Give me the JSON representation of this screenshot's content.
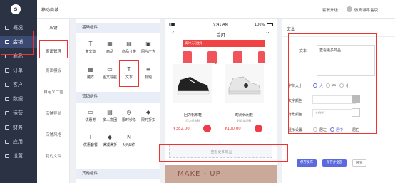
{
  "side": {
    "items": [
      {
        "label": "概况",
        "icon": "dashboard-icon"
      },
      {
        "label": "店铺",
        "icon": "store-icon"
      },
      {
        "label": "商品",
        "icon": "goods-icon"
      },
      {
        "label": "订单",
        "icon": "order-icon"
      },
      {
        "label": "客户",
        "icon": "customer-icon"
      },
      {
        "label": "数据",
        "icon": "data-icon"
      },
      {
        "label": "运营",
        "icon": "operations-icon"
      },
      {
        "label": "财务",
        "icon": "finance-icon"
      },
      {
        "label": "应用",
        "icon": "apps-icon"
      },
      {
        "label": "设置",
        "icon": "settings-icon"
      }
    ]
  },
  "topbar": {
    "breadcrumb": "移动商城",
    "upgrade": "套餐升级",
    "user": "微商城零售版"
  },
  "sub": {
    "items": [
      "店铺",
      "页面管理",
      "页面模板",
      "自定义广告",
      "店铺导航",
      "店铺风格",
      "我的文件"
    ]
  },
  "comp": {
    "basic_header": "基础组件",
    "basic": [
      "富文本",
      "商品",
      "商品分类",
      "图片广告",
      "魔方",
      "图文导航",
      "文本",
      "标题"
    ],
    "marketing_header": "营销组件",
    "marketing": [
      "优惠券",
      "多人拼团",
      "限时秒杀",
      "限时折扣",
      "优惠套餐",
      "满减满折",
      "N元N件"
    ],
    "other_header": "其他组件"
  },
  "phone": {
    "time": "9:41 AM",
    "battery": "100%",
    "title": "首页",
    "banner": "满99元可使用",
    "products": [
      {
        "name": "回力帆布鞋",
        "desc": "回力帆布鞋",
        "price": "¥382.00"
      },
      {
        "name": "时尚休闲鞋",
        "desc": "时尚休闲鞋",
        "price": "¥100.00"
      }
    ],
    "more_text": "查看更多商品",
    "model_text": "MAKE - UP"
  },
  "props": {
    "title": "文本",
    "text_label": "文本",
    "text_value": "查看更多商品...",
    "size_label": "字体大小",
    "sizes": [
      "大",
      "中",
      "小"
    ],
    "color_label": "文字颜色",
    "bg_label": "背景颜色",
    "bg_value": "#ffffff",
    "display_label": "显示设置",
    "align": [
      "居左",
      "居中",
      "居右"
    ],
    "btn_save_publish": "保存发布",
    "btn_save_draft": "保存并全部",
    "btn_preview": "预览"
  },
  "colors": {
    "sidebar": "#2b3244",
    "accent": "#5b6bdf",
    "highlight": "#e33333",
    "price": "#e83b3b"
  }
}
